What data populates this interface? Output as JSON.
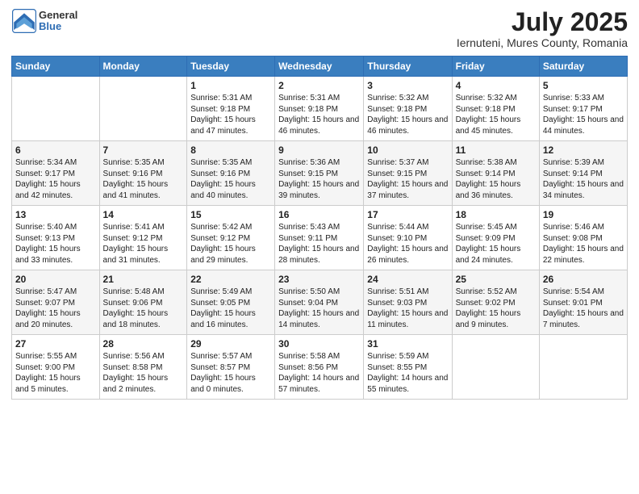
{
  "header": {
    "logo_line1": "General",
    "logo_line2": "Blue",
    "title": "July 2025",
    "subtitle": "Iernuteni, Mures County, Romania"
  },
  "weekdays": [
    "Sunday",
    "Monday",
    "Tuesday",
    "Wednesday",
    "Thursday",
    "Friday",
    "Saturday"
  ],
  "weeks": [
    [
      {
        "day": "",
        "info": ""
      },
      {
        "day": "",
        "info": ""
      },
      {
        "day": "1",
        "info": "Sunrise: 5:31 AM\nSunset: 9:18 PM\nDaylight: 15 hours and 47 minutes."
      },
      {
        "day": "2",
        "info": "Sunrise: 5:31 AM\nSunset: 9:18 PM\nDaylight: 15 hours and 46 minutes."
      },
      {
        "day": "3",
        "info": "Sunrise: 5:32 AM\nSunset: 9:18 PM\nDaylight: 15 hours and 46 minutes."
      },
      {
        "day": "4",
        "info": "Sunrise: 5:32 AM\nSunset: 9:18 PM\nDaylight: 15 hours and 45 minutes."
      },
      {
        "day": "5",
        "info": "Sunrise: 5:33 AM\nSunset: 9:17 PM\nDaylight: 15 hours and 44 minutes."
      }
    ],
    [
      {
        "day": "6",
        "info": "Sunrise: 5:34 AM\nSunset: 9:17 PM\nDaylight: 15 hours and 42 minutes."
      },
      {
        "day": "7",
        "info": "Sunrise: 5:35 AM\nSunset: 9:16 PM\nDaylight: 15 hours and 41 minutes."
      },
      {
        "day": "8",
        "info": "Sunrise: 5:35 AM\nSunset: 9:16 PM\nDaylight: 15 hours and 40 minutes."
      },
      {
        "day": "9",
        "info": "Sunrise: 5:36 AM\nSunset: 9:15 PM\nDaylight: 15 hours and 39 minutes."
      },
      {
        "day": "10",
        "info": "Sunrise: 5:37 AM\nSunset: 9:15 PM\nDaylight: 15 hours and 37 minutes."
      },
      {
        "day": "11",
        "info": "Sunrise: 5:38 AM\nSunset: 9:14 PM\nDaylight: 15 hours and 36 minutes."
      },
      {
        "day": "12",
        "info": "Sunrise: 5:39 AM\nSunset: 9:14 PM\nDaylight: 15 hours and 34 minutes."
      }
    ],
    [
      {
        "day": "13",
        "info": "Sunrise: 5:40 AM\nSunset: 9:13 PM\nDaylight: 15 hours and 33 minutes."
      },
      {
        "day": "14",
        "info": "Sunrise: 5:41 AM\nSunset: 9:12 PM\nDaylight: 15 hours and 31 minutes."
      },
      {
        "day": "15",
        "info": "Sunrise: 5:42 AM\nSunset: 9:12 PM\nDaylight: 15 hours and 29 minutes."
      },
      {
        "day": "16",
        "info": "Sunrise: 5:43 AM\nSunset: 9:11 PM\nDaylight: 15 hours and 28 minutes."
      },
      {
        "day": "17",
        "info": "Sunrise: 5:44 AM\nSunset: 9:10 PM\nDaylight: 15 hours and 26 minutes."
      },
      {
        "day": "18",
        "info": "Sunrise: 5:45 AM\nSunset: 9:09 PM\nDaylight: 15 hours and 24 minutes."
      },
      {
        "day": "19",
        "info": "Sunrise: 5:46 AM\nSunset: 9:08 PM\nDaylight: 15 hours and 22 minutes."
      }
    ],
    [
      {
        "day": "20",
        "info": "Sunrise: 5:47 AM\nSunset: 9:07 PM\nDaylight: 15 hours and 20 minutes."
      },
      {
        "day": "21",
        "info": "Sunrise: 5:48 AM\nSunset: 9:06 PM\nDaylight: 15 hours and 18 minutes."
      },
      {
        "day": "22",
        "info": "Sunrise: 5:49 AM\nSunset: 9:05 PM\nDaylight: 15 hours and 16 minutes."
      },
      {
        "day": "23",
        "info": "Sunrise: 5:50 AM\nSunset: 9:04 PM\nDaylight: 15 hours and 14 minutes."
      },
      {
        "day": "24",
        "info": "Sunrise: 5:51 AM\nSunset: 9:03 PM\nDaylight: 15 hours and 11 minutes."
      },
      {
        "day": "25",
        "info": "Sunrise: 5:52 AM\nSunset: 9:02 PM\nDaylight: 15 hours and 9 minutes."
      },
      {
        "day": "26",
        "info": "Sunrise: 5:54 AM\nSunset: 9:01 PM\nDaylight: 15 hours and 7 minutes."
      }
    ],
    [
      {
        "day": "27",
        "info": "Sunrise: 5:55 AM\nSunset: 9:00 PM\nDaylight: 15 hours and 5 minutes."
      },
      {
        "day": "28",
        "info": "Sunrise: 5:56 AM\nSunset: 8:58 PM\nDaylight: 15 hours and 2 minutes."
      },
      {
        "day": "29",
        "info": "Sunrise: 5:57 AM\nSunset: 8:57 PM\nDaylight: 15 hours and 0 minutes."
      },
      {
        "day": "30",
        "info": "Sunrise: 5:58 AM\nSunset: 8:56 PM\nDaylight: 14 hours and 57 minutes."
      },
      {
        "day": "31",
        "info": "Sunrise: 5:59 AM\nSunset: 8:55 PM\nDaylight: 14 hours and 55 minutes."
      },
      {
        "day": "",
        "info": ""
      },
      {
        "day": "",
        "info": ""
      }
    ]
  ]
}
